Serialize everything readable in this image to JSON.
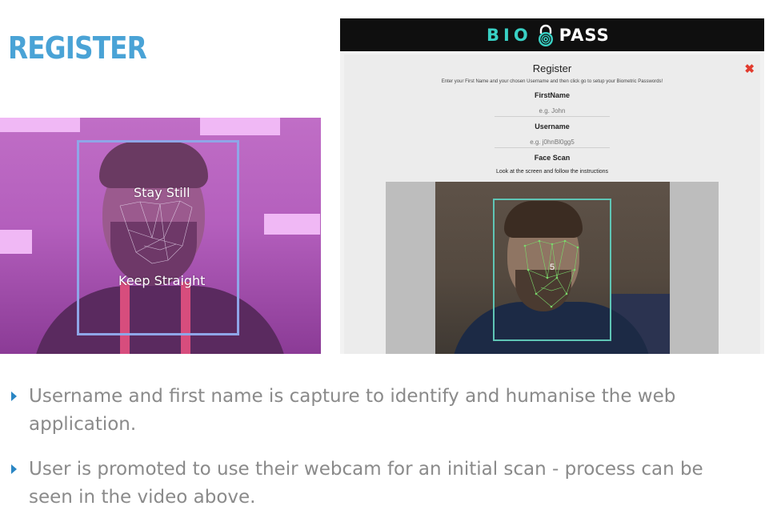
{
  "slide": {
    "title": "REGISTER"
  },
  "left_video": {
    "overlay_top": "Stay Still",
    "overlay_bottom": "Keep Straight"
  },
  "app": {
    "logo_left": "BIO",
    "logo_right": "PASS",
    "modal_title": "Register",
    "close_icon": "close-icon",
    "instructions": "Enter your First Name and your chosen Username and then click go to setup your Biometric Passwords!",
    "firstname_label": "FirstName",
    "firstname_placeholder": "e.g. John",
    "username_label": "Username",
    "username_placeholder": "e.g. j0hnBl0gg5",
    "facescan_label": "Face Scan",
    "facescan_hint": "Look at the screen and follow the instructions",
    "countdown": "5"
  },
  "bullets": [
    "Username and first name is capture to identify and humanise the web application.",
    "User is promoted to use their webcam for an initial scan - process can be seen in the video above."
  ],
  "colors": {
    "title": "#4aa3d6",
    "bullet_arrow": "#2a86c4",
    "bullet_text": "#8a8a8a",
    "logo_accent": "#39d0c4",
    "close": "#e23b2e"
  }
}
